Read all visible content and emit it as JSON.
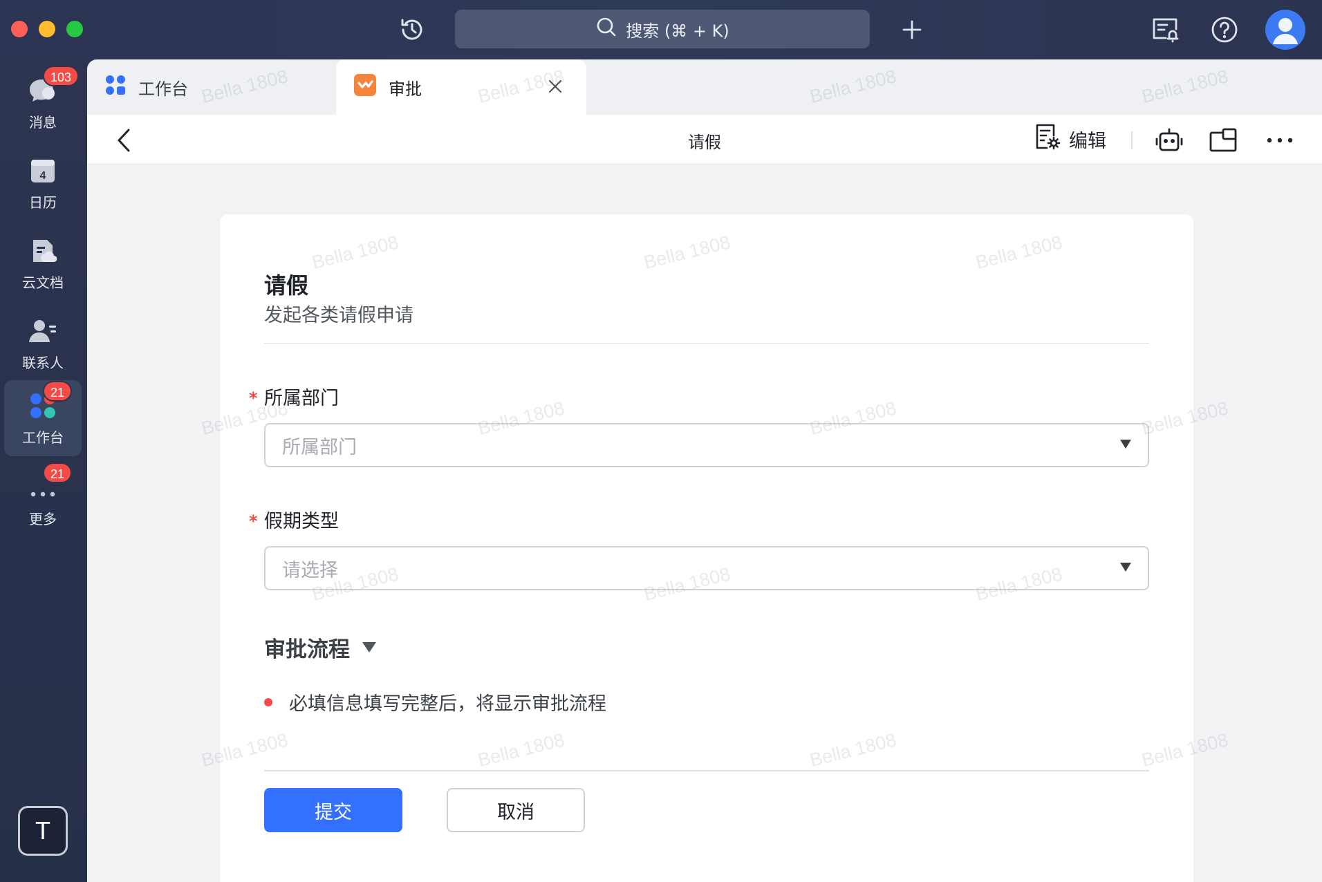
{
  "titlebar": {
    "search_placeholder": "搜索 (⌘ + K)",
    "icons": [
      "history-icon",
      "search-icon",
      "plus-icon",
      "meeting-room-icon",
      "help-icon",
      "avatar-icon"
    ]
  },
  "sidebar": {
    "items": [
      {
        "label": "消息",
        "badge": "103",
        "icon": "message-icon"
      },
      {
        "label": "日历",
        "badge": "",
        "icon": "calendar-icon",
        "calendar_day": "4"
      },
      {
        "label": "云文档",
        "badge": "",
        "icon": "cloud-doc-icon"
      },
      {
        "label": "联系人",
        "badge": "",
        "icon": "contacts-icon"
      },
      {
        "label": "工作台",
        "badge": "21",
        "icon": "workbench-icon",
        "active": true
      },
      {
        "label": "更多",
        "badge": "21",
        "icon": "more-icon"
      }
    ],
    "tenant_initial": "T"
  },
  "tabs": [
    {
      "label": "工作台",
      "icon": "workbench-icon"
    },
    {
      "label": "审批",
      "icon": "approval-icon",
      "active": true
    }
  ],
  "header": {
    "title": "请假",
    "edit_label": "编辑",
    "icons": [
      "back-icon",
      "form-settings-icon",
      "bot-icon",
      "split-view-icon",
      "more-horizontal-icon"
    ]
  },
  "form": {
    "title": "请假",
    "subtitle": "发起各类请假申请",
    "fields": [
      {
        "label": "所属部门",
        "required": true,
        "placeholder": "所属部门"
      },
      {
        "label": "假期类型",
        "required": true,
        "placeholder": "请选择"
      }
    ],
    "required_mark": "*",
    "flow_title": "审批流程",
    "flow_note": "必填信息填写完整后，将显示审批流程",
    "submit_label": "提交",
    "cancel_label": "取消"
  },
  "watermark": "Bella 1808",
  "colors": {
    "primary": "#3370ff",
    "required": "#f54a45",
    "sidebar_bg": "#2c3450",
    "approval_orange": "#f5843d"
  }
}
